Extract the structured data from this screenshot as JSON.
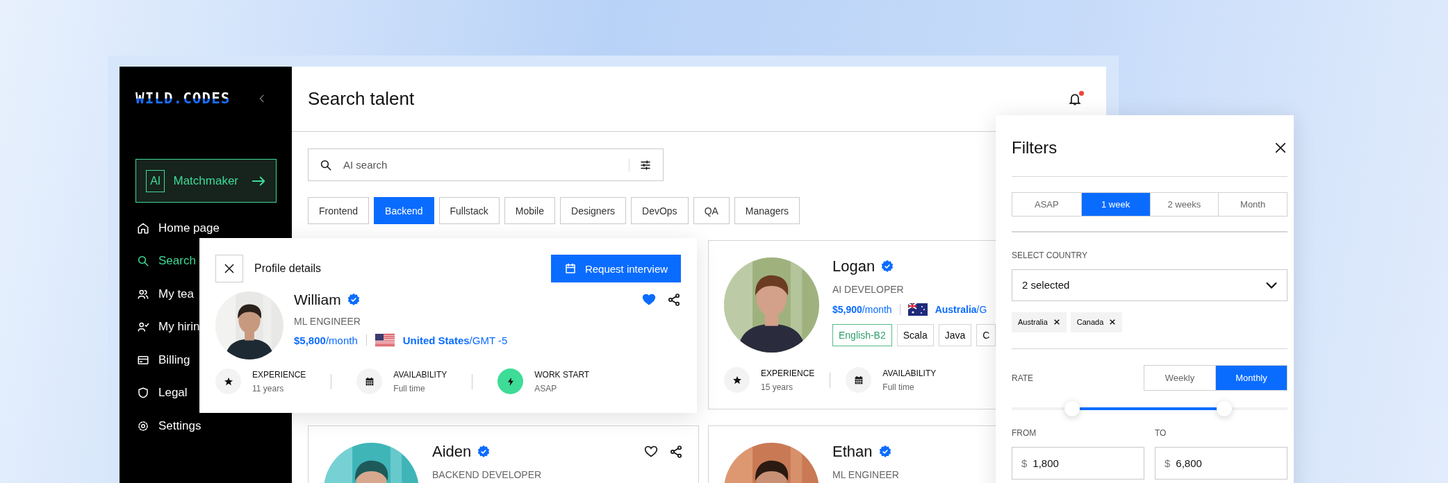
{
  "sidebar": {
    "logo": "WILD.CODES",
    "matchmaker": {
      "badge": "AI",
      "label": "Matchmaker"
    },
    "items": [
      {
        "label": "Home page",
        "selected": false
      },
      {
        "label": "Search",
        "selected": true
      },
      {
        "label": "My tea",
        "selected": false
      },
      {
        "label": "My hirin",
        "selected": false
      },
      {
        "label": "Billing",
        "selected": false
      },
      {
        "label": "Legal",
        "selected": false
      },
      {
        "label": "Settings",
        "selected": false
      }
    ]
  },
  "header": {
    "title": "Search talent",
    "unread": true
  },
  "search": {
    "placeholder": "AI search"
  },
  "categories": [
    {
      "label": "Frontend",
      "selected": false
    },
    {
      "label": "Backend",
      "selected": true
    },
    {
      "label": "Fullstack",
      "selected": false
    },
    {
      "label": "Mobile",
      "selected": false
    },
    {
      "label": "Designers",
      "selected": false
    },
    {
      "label": "DevOps",
      "selected": false
    },
    {
      "label": "QA",
      "selected": false
    },
    {
      "label": "Managers",
      "selected": false
    }
  ],
  "cards": [
    {
      "name": "Logan",
      "verified": true,
      "role": "AI DEVELOPER",
      "rate": "**$5,900**/month",
      "location": "**Australia**/G",
      "tags": [
        {
          "label": "English-B2",
          "kind": "language"
        },
        {
          "label": "Scala",
          "kind": "skill"
        },
        {
          "label": "Java",
          "kind": "skill"
        },
        {
          "label": "C",
          "kind": "skill"
        }
      ],
      "stats": [
        {
          "label": "EXPERIENCE",
          "value": "15 years"
        },
        {
          "label": "AVAILABILITY",
          "value": "Full time"
        }
      ]
    },
    {
      "name": "Aiden",
      "verified": true,
      "role": "BACKEND DEVELOPER",
      "favorite": false
    },
    {
      "name": "Ethan",
      "verified": true,
      "role": "ML ENGINEER"
    }
  ],
  "profile": {
    "title": "Profile details",
    "button": "Request interview",
    "name": "William",
    "verified": true,
    "role": "ML ENGINEER",
    "rate": "**$5,800**/month",
    "location": "**United States**/GMT -5",
    "favorite": true,
    "stats": [
      {
        "label": "EXPERIENCE",
        "value": "11 years"
      },
      {
        "label": "AVAILABILITY",
        "value": "Full time"
      },
      {
        "label": "WORK START",
        "value": "ASAP"
      }
    ]
  },
  "filters": {
    "title": "Filters",
    "start_options": [
      {
        "label": "ASAP",
        "selected": false
      },
      {
        "label": "1 week",
        "selected": true
      },
      {
        "label": "2 weeks",
        "selected": false
      },
      {
        "label": "Month",
        "selected": false
      }
    ],
    "country_label": "SELECT COUNTRY",
    "country_value": "2 selected",
    "countries": [
      "Australia",
      "Canada"
    ],
    "rate_label": "RATE",
    "rate_modes": [
      {
        "label": "Weekly",
        "selected": false
      },
      {
        "label": "Monthly",
        "selected": true
      }
    ],
    "thumbs": [
      {
        "level": 0.22
      },
      {
        "level": 0.77
      }
    ],
    "from": {
      "label": "FROM",
      "currency": "$",
      "value": "1,800"
    },
    "to": {
      "label": "TO",
      "currency": "$",
      "value": "6,800"
    }
  }
}
